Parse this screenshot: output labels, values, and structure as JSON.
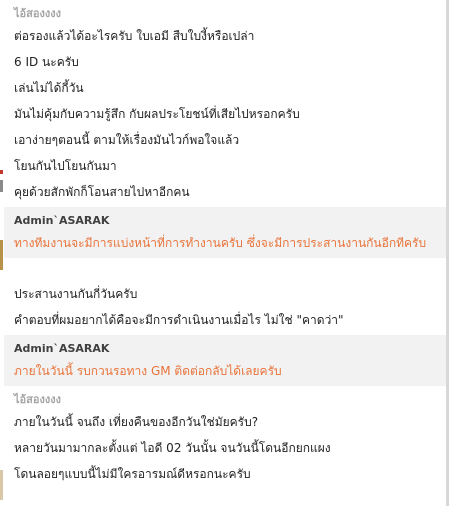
{
  "colors": {
    "user_name": "#a6a6a6",
    "admin_name": "#404040",
    "admin_text": "#e8743b",
    "message_text": "#222222",
    "admin_background": "#f2f2f2"
  },
  "groups": [
    {
      "sender": "ไอ้สองงงง",
      "messages": [
        "ต่อรองแล้วได้อะไรครับ ใบเอมี สืบใบงี้หรือเปล่า",
        "6 ID นะครับ",
        "เล่นไม่ได้กี้วัน",
        "มันไม่คุ้มกับความรู้สึก กับผลประโยชน์ที่เสียไปหรอกครับ",
        "เอาง่ายๆตอนนี้ ตามให้เรื่องมันไวก์พอใจแล้ว",
        "โยนกันไปโยนกันมา",
        "คุยด้วยสักพักก็โอนสายไปหาอีกคน"
      ]
    },
    {
      "sender": "Admin`ASARAK",
      "messages": [
        "ทางทีมงานจะมีการแบ่งหน้าที่การทำงานครับ ซึ่งจะมีการประสานงานกันอีกทีครับ"
      ]
    },
    {
      "sender": "",
      "messages": [
        "ประสานงานกันกี่วันครับ",
        "คำตอบที่ผมอยากได้คือจะมีการดำเนินงานเมื่อไร ไม่ใช่ \"คาดว่า\""
      ]
    },
    {
      "sender": "Admin`ASARAK",
      "messages": [
        "ภายในวันนี้ รบกวนรอทาง GM ติดต่อกลับได้เลยครับ"
      ]
    },
    {
      "sender": "ไอ้สองงงง",
      "messages": [
        "ภายในวันนี้ จนถึง เที่ยงคืนของอีกวันใช่มัยครับ?",
        "หลายวันมามากละตั้งแต่ ไอดี 02 วันนั้น จนวันนี้โดนอีกยกแผง",
        "โดนลอยๆแบบนี้ไม่มีใครอารมณ์ดีหรอกนะครับ"
      ]
    }
  ]
}
